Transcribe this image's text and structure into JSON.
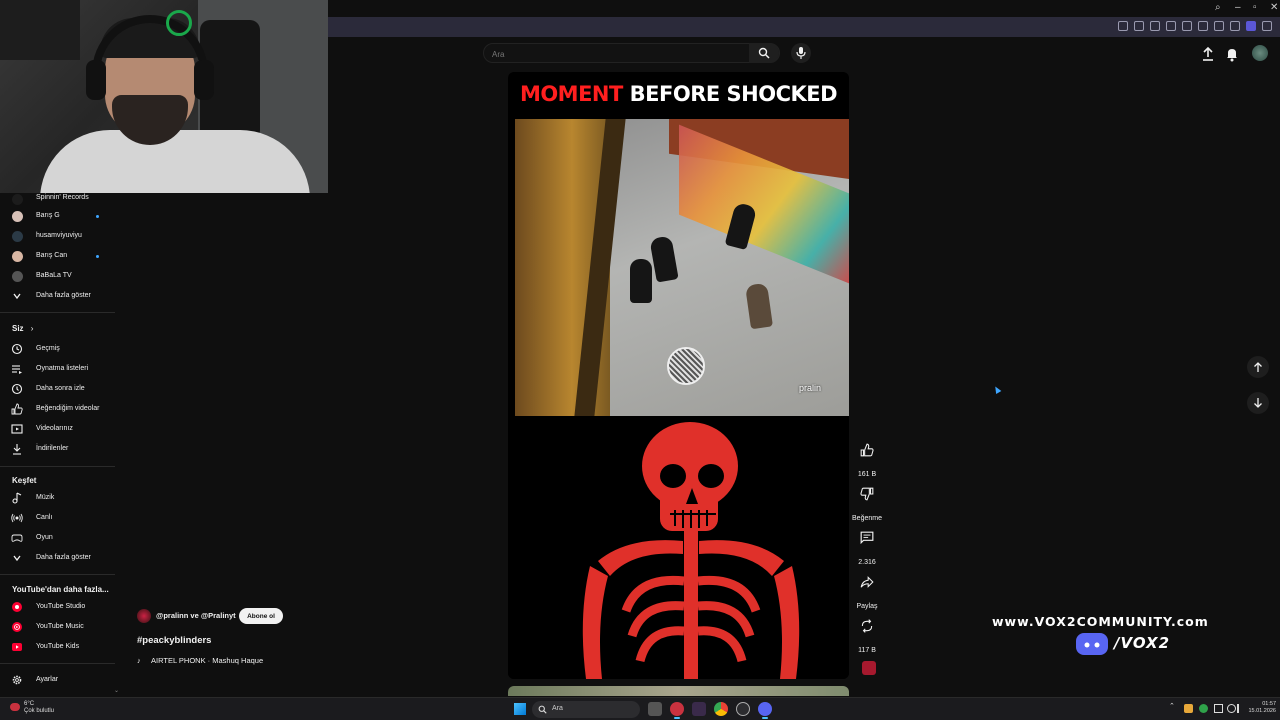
{
  "search": {
    "placeholder": "Ara"
  },
  "sidebar": {
    "subscriptions": [
      {
        "label": "Spinnin' Records",
        "new": false,
        "color": "#1c1c1c"
      },
      {
        "label": "Barış G",
        "new": true,
        "color": "#d8c1b8"
      },
      {
        "label": "husamviyuviyu",
        "new": false,
        "color": "#2b3a46"
      },
      {
        "label": "Barış Can",
        "new": true,
        "color": "#d9b7a4"
      },
      {
        "label": "BaBaLa TV",
        "new": false,
        "color": "#555555"
      }
    ],
    "show_more_1": "Daha fazla göster",
    "you_heading": "Siz",
    "you_items": [
      {
        "label": "Geçmiş",
        "icon": "history-icon"
      },
      {
        "label": "Oynatma listeleri",
        "icon": "playlists-icon"
      },
      {
        "label": "Daha sonra izle",
        "icon": "watch-later-icon"
      },
      {
        "label": "Beğendiğim videolar",
        "icon": "liked-videos-icon"
      },
      {
        "label": "Videolarınız",
        "icon": "your-videos-icon"
      },
      {
        "label": "İndirilenler",
        "icon": "downloads-icon"
      }
    ],
    "explore_heading": "Keşfet",
    "explore_items": [
      {
        "label": "Müzik",
        "icon": "music-icon"
      },
      {
        "label": "Canlı",
        "icon": "live-icon"
      },
      {
        "label": "Oyun",
        "icon": "gaming-icon"
      }
    ],
    "show_more_2": "Daha fazla göster",
    "more_heading": "YouTube'dan daha fazla...",
    "more_items": [
      {
        "label": "YouTube Studio"
      },
      {
        "label": "YouTube Music"
      },
      {
        "label": "YouTube Kids"
      }
    ],
    "settings": "Ayarlar"
  },
  "short": {
    "title_red": "MOMENT",
    "title_white": "BEFORE SHOCKED",
    "watermark": "pralin"
  },
  "actions": {
    "like_count": "161 B",
    "dislike_label": "Beğenme",
    "comment_count": "2.316",
    "share_label": "Paylaş",
    "remix_count": "117 B"
  },
  "channel": {
    "name": "@pralinn ve @Pralinyt",
    "subscribe_label": "Abone ol",
    "hashtag": "#peackyblinders",
    "music": "AIRTEL PHONK · Mashuq Haque"
  },
  "overlay": {
    "url": "www.VOX2COMMUNITY.com",
    "discord": "/VOX2"
  },
  "taskbar": {
    "weather_temp": "6°C",
    "weather_desc": "Çok bulutlu",
    "search_label": "Ara",
    "time": "01:57",
    "date": "15.01.2026"
  },
  "colors": {
    "yt_red": "#ff0033",
    "accent_blue": "#3ea6ff",
    "background": "#0f0f0f",
    "title_red": "#ff1f1f",
    "discord": "#5865f2"
  }
}
